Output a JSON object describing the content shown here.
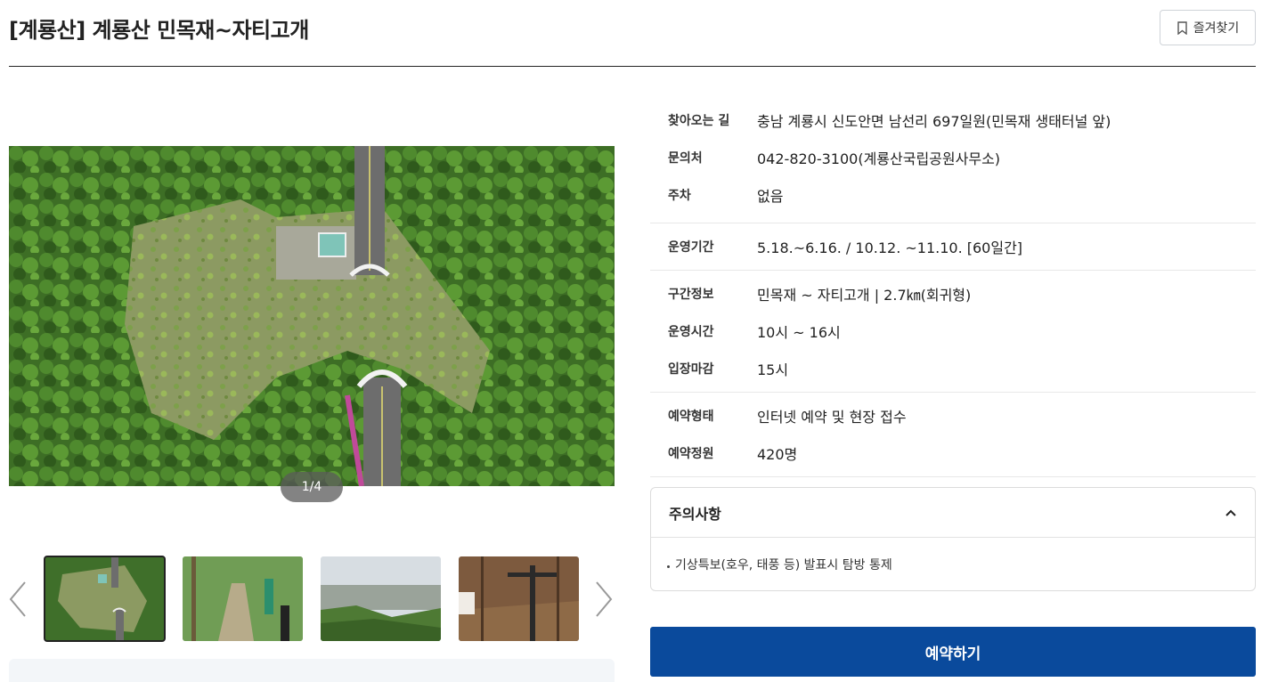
{
  "header": {
    "title": "[계룡산] 계룡산 민목재~자티고개",
    "favorite_label": "즐겨찾기"
  },
  "gallery": {
    "pager": "1/4",
    "thumbnails": [
      {
        "name": "aerial-road-tunnel"
      },
      {
        "name": "forest-stairs-trail"
      },
      {
        "name": "mountain-city-view"
      },
      {
        "name": "winter-forest-signpost"
      }
    ]
  },
  "info": {
    "groups": [
      {
        "rows": [
          {
            "label": "찾아오는 길",
            "value": "충남 계룡시 신도안면 남선리 697일원(민목재 생태터널 앞)"
          },
          {
            "label": "문의처",
            "value": "042-820-3100(계룡산국립공원사무소)"
          },
          {
            "label": "주차",
            "value": "없음"
          }
        ]
      },
      {
        "rows": [
          {
            "label": "운영기간",
            "value": "5.18.~6.16. / 10.12. ~11.10. [60일간]"
          }
        ]
      },
      {
        "rows": [
          {
            "label": "구간정보",
            "value": "민목재 ~ 자티고개 | 2.7㎞(회귀형)"
          },
          {
            "label": "운영시간",
            "value": "10시 ~ 16시"
          },
          {
            "label": "입장마감",
            "value": "15시"
          }
        ]
      },
      {
        "rows": [
          {
            "label": "예약형태",
            "value": "인터넷 예약 및 현장 접수"
          },
          {
            "label": "예약정원",
            "value": "420명"
          }
        ]
      }
    ]
  },
  "caution": {
    "title": "주의사항",
    "items": [
      "기상특보(호우, 태풍 등) 발표시 탐방 통제"
    ]
  },
  "reserve_label": "예약하기",
  "colors": {
    "primary": "#0a4a9c",
    "text": "#222222",
    "border": "#e8e8e8"
  }
}
